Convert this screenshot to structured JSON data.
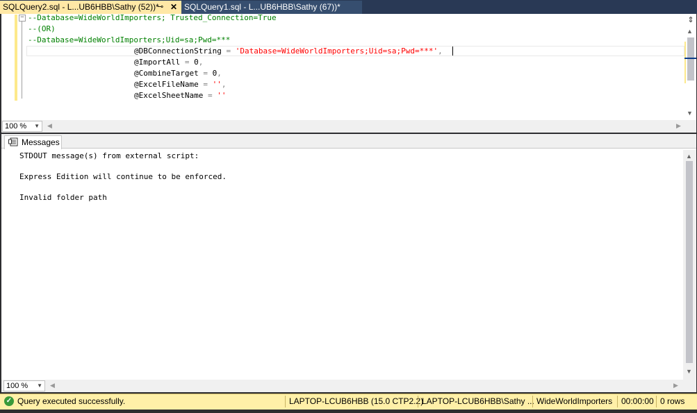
{
  "tabs": [
    {
      "label": "SQLQuery2.sql - L...UB6HBB\\Sathy (52))*",
      "active": true,
      "pin_icon": "pin-icon",
      "close_icon": "close-icon"
    },
    {
      "label": "SQLQuery1.sql - L...UB6HBB\\Sathy (67))*",
      "active": false
    }
  ],
  "editor": {
    "lines": [
      {
        "comment": "--Database=WideWorldImporters; Trusted_Connection=True"
      },
      {
        "comment": "--(OR)"
      },
      {
        "comment": "--Database=WideWorldImporters;Uid=sa;Pwd=***"
      },
      {
        "param": "@DBConnectionString",
        "op": "=",
        "value": "'Database=WideWorldImporters;Uid=sa;Pwd=***'",
        "tail": ","
      },
      {
        "param": "@ImportAll",
        "op": "=",
        "value": "0",
        "tail": ","
      },
      {
        "param": "@CombineTarget",
        "op": "=",
        "value": "0",
        "tail": ","
      },
      {
        "param": "@ExcelFileName",
        "op": "=",
        "value": "''",
        "tail": ","
      },
      {
        "param": "@ExcelSheetName",
        "op": "=",
        "value": "''",
        "tail": ""
      }
    ]
  },
  "editor_zoom": "100 %",
  "results": {
    "tab_label": "Messages",
    "messages": [
      "STDOUT message(s) from external script:",
      "Express Edition will continue to be enforced.",
      "Invalid folder path"
    ]
  },
  "results_zoom": "100 %",
  "status": {
    "message": "Query executed successfully.",
    "server": "LAPTOP-LCUB6HBB (15.0 CTP2.2)",
    "user": "LAPTOP-LCUB6HBB\\Sathy ...",
    "database": "WideWorldImporters",
    "elapsed": "00:00:00",
    "rows": "0 rows"
  },
  "colors": {
    "tab_active_bg": "#ffe8a6",
    "tab_inactive_bg": "#364e6f",
    "comment": "#008000",
    "string": "#ff0000",
    "status_bg": "#fff0a8"
  }
}
